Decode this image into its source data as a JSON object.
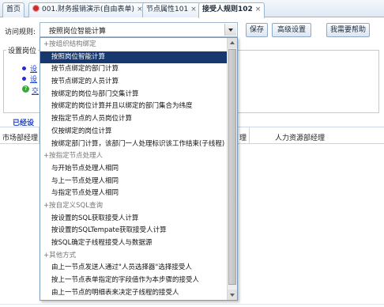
{
  "tabs": [
    {
      "label": "首页",
      "active": false
    },
    {
      "label": "001.财务报销演示(自由表单)",
      "active": false
    },
    {
      "label": "节点属性101",
      "active": false
    },
    {
      "label": "接受人规则102",
      "active": true
    }
  ],
  "toolbar": {
    "access_rule_label": "访问规则:",
    "selected_rule": "按照岗位智能计算",
    "save_label": "保存",
    "advanced_label": "高级设置",
    "help_label": "我需要帮助"
  },
  "settings": {
    "legend": "设置岗位",
    "link1": "设",
    "link2": "设",
    "link3": "交"
  },
  "configured_label": "已经设",
  "table": {
    "col1": "市场部经理",
    "col2": "理",
    "col3": "人力资源部经理"
  },
  "dropdown": {
    "items": [
      {
        "label": "+按组织结构绑定",
        "type": "group"
      },
      {
        "label": "按照岗位智能计算",
        "type": "option",
        "selected": true
      },
      {
        "label": "按节点绑定的部门计算",
        "type": "option"
      },
      {
        "label": "按节点绑定的人员计算",
        "type": "option"
      },
      {
        "label": "按绑定的岗位与部门交集计算",
        "type": "option"
      },
      {
        "label": "按绑定的岗位计算并且以绑定的部门集合为纬度",
        "type": "option"
      },
      {
        "label": "按指定节点的人员岗位计算",
        "type": "option"
      },
      {
        "label": "仅按绑定的岗位计算",
        "type": "option"
      },
      {
        "label": "按绑定部门计算，该部门一人处理标识该工作结束(子线程)",
        "type": "option"
      },
      {
        "label": "+按指定节点处理人",
        "type": "group"
      },
      {
        "label": "与开始节点处理人相同",
        "type": "option"
      },
      {
        "label": "与上一节点处理人相同",
        "type": "option"
      },
      {
        "label": "与指定节点处理人相同",
        "type": "option"
      },
      {
        "label": "+按自定义SQL查询",
        "type": "group"
      },
      {
        "label": "按设置的SQL获取接受人计算",
        "type": "option"
      },
      {
        "label": "按设置的SQLTempate获取接受人计算",
        "type": "option"
      },
      {
        "label": "按SQL确定子线程接受人与数据源",
        "type": "option"
      },
      {
        "label": "+其他方式",
        "type": "group"
      },
      {
        "label": "由上一节点发送人通过\"人员选择器\"选择接受人",
        "type": "option"
      },
      {
        "label": "按上一节点表单指定的字段值作为本步骤的接受人",
        "type": "option"
      },
      {
        "label": "由上一节点的明细表来决定子线程的接受人",
        "type": "option"
      }
    ]
  }
}
